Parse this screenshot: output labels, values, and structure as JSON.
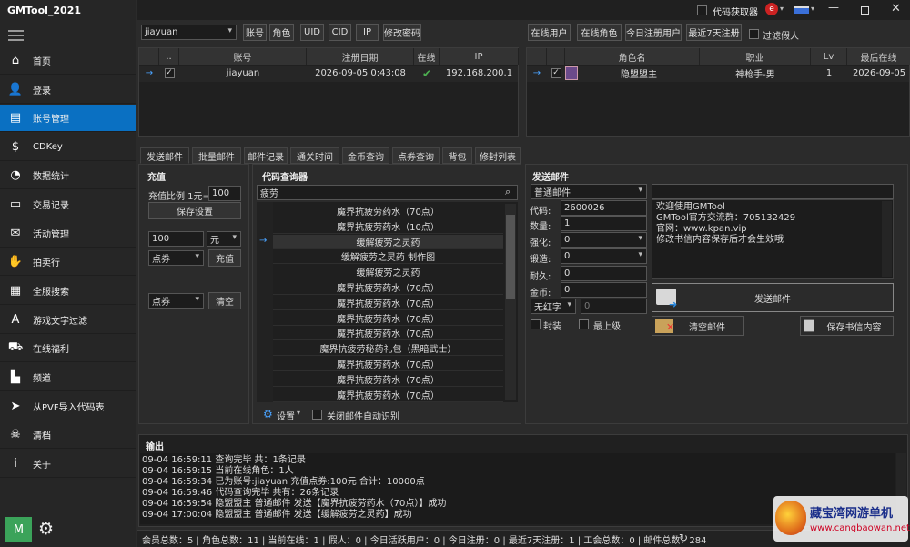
{
  "app": {
    "title": "GMTool_2021",
    "code_fetcher": "代码获取器",
    "menu_initial": "M"
  },
  "sidebar": {
    "items": [
      {
        "label": "首页",
        "icon": "home-icon",
        "glyph": "⌂"
      },
      {
        "label": "登录",
        "icon": "user-login-icon",
        "glyph": "👤"
      },
      {
        "label": "账号管理",
        "icon": "id-card-icon",
        "glyph": "▤",
        "active": true
      },
      {
        "label": "CDKey",
        "icon": "dollar-icon",
        "glyph": "$"
      },
      {
        "label": "数据统计",
        "icon": "chart-icon",
        "glyph": "◔"
      },
      {
        "label": "交易记录",
        "icon": "log-icon",
        "glyph": "▭"
      },
      {
        "label": "活动管理",
        "icon": "coupon-icon",
        "glyph": "✉"
      },
      {
        "label": "拍卖行",
        "icon": "auction-icon",
        "glyph": "✋"
      },
      {
        "label": "全服搜索",
        "icon": "server-icon",
        "glyph": "▦"
      },
      {
        "label": "游戏文字过滤",
        "icon": "text-filter-icon",
        "glyph": "A"
      },
      {
        "label": "在线福利",
        "icon": "truck-icon",
        "glyph": "⛟"
      },
      {
        "label": "频道",
        "icon": "factory-icon",
        "glyph": "▙"
      },
      {
        "label": "从PVF导入代码表",
        "icon": "cursor-icon",
        "glyph": "➤"
      },
      {
        "label": "清档",
        "icon": "skull-icon",
        "glyph": "☠"
      },
      {
        "label": "关于",
        "icon": "info-icon",
        "glyph": "i"
      }
    ]
  },
  "toolbar": {
    "account_value": "jiayuan",
    "buttons": [
      "账号",
      "角色",
      "UID",
      "CID",
      "IP",
      "修改密码"
    ],
    "right_buttons": [
      "在线用户",
      "在线角色",
      "今日注册用户",
      "最近7天注册"
    ],
    "filter_fake": "过滤假人"
  },
  "accounts": {
    "headers": [
      "..",
      "账号",
      "注册日期",
      "在线",
      "IP"
    ],
    "rows": [
      {
        "arrow": "→",
        "checked": "✓",
        "account": "jiayuan",
        "date": "2026-09-05 0:43:08",
        "online": "✔",
        "ip": "192.168.200.1"
      }
    ]
  },
  "characters": {
    "headers": [
      "角色名",
      "职业",
      "Lv",
      "最后在线"
    ],
    "rows": [
      {
        "arrow": "→",
        "checked": "✓",
        "name": "隐盟盟主",
        "job": "神枪手-男",
        "lv": "1",
        "last": "2026-09-05"
      }
    ]
  },
  "tabs": [
    "发送邮件",
    "批量邮件",
    "邮件记录",
    "通关时间",
    "金币查询",
    "点券查询",
    "背包",
    "修封列表"
  ],
  "recharge": {
    "title": "充值",
    "ratio_label": "充值比例 1元=",
    "ratio_value": "100",
    "save_label": "保存设置",
    "amount": "100",
    "unit": "元",
    "type1": "点券",
    "charge_label": "充值",
    "type2": "点券",
    "clear_label": "清空"
  },
  "code_query": {
    "title": "代码查询器",
    "search": "疲劳",
    "items": [
      "魔界抗疲劳药水（70点）",
      "魔界抗疲劳药水（10点）",
      "缓解疲劳之灵药",
      "缓解疲劳之灵药 制作图",
      "缓解疲劳之灵药",
      "魔界抗疲劳药水（70点）",
      "魔界抗疲劳药水（70点）",
      "魔界抗疲劳药水（70点）",
      "魔界抗疲劳药水（70点）",
      "魔界抗疲劳秘药礼包（黑暗武士）",
      "魔界抗疲劳药水（70点）",
      "魔界抗疲劳药水（70点）",
      "魔界抗疲劳药水（70点）"
    ],
    "settings": "设置",
    "auto_close": "关闭邮件自动识别"
  },
  "send_mail": {
    "title": "发送邮件",
    "mail_type": "普通邮件",
    "code_label": "代码:",
    "code": "2600026",
    "qty_label": "数量:",
    "qty": "1",
    "enhance_label": "强化:",
    "enhance": "0",
    "forge_label": "锻造:",
    "forge": "0",
    "durability_label": "耐久:",
    "durability": "0",
    "gold_label": "金币:",
    "gold": "0",
    "red_label": "无红字",
    "red_value": "0",
    "seal_label": "封装",
    "top_label": "最上级",
    "message": [
      "欢迎使用GMTool",
      "GMTool官方交流群：705132429",
      "官网：www.kpan.vip",
      "修改书信内容保存后才会生效哦"
    ],
    "send_label": "发送邮件",
    "clear_label": "清空邮件",
    "save_label": "保存书信内容"
  },
  "output": {
    "title": "输出",
    "lines": [
      "09-04 16:59:11 查询完毕 共：1条记录",
      "09-04 16:59:15 当前在线角色：1人",
      "09-04 16:59:34 已为账号:jiayuan 充值点券:100元 合计：10000点",
      "09-04 16:59:46 代码查询完毕 共有：26条记录",
      "09-04 16:59:54 隐盟盟主 普通邮件 发送【魔界抗疲劳药水（70点）】成功",
      "09-04 17:00:04 隐盟盟主 普通邮件 发送【缓解疲劳之灵药】成功"
    ]
  },
  "status": "会员总数：5 | 角色总数：11 | 当前在线：1 | 假人：0 | 今日活跃用户：0 | 今日注册：0 | 最近7天注册：1 | 工会总数：0 | 邮件总数：284",
  "watermark": {
    "line1": "藏宝湾网游单机",
    "line2": "www.cangbaowan.net"
  }
}
